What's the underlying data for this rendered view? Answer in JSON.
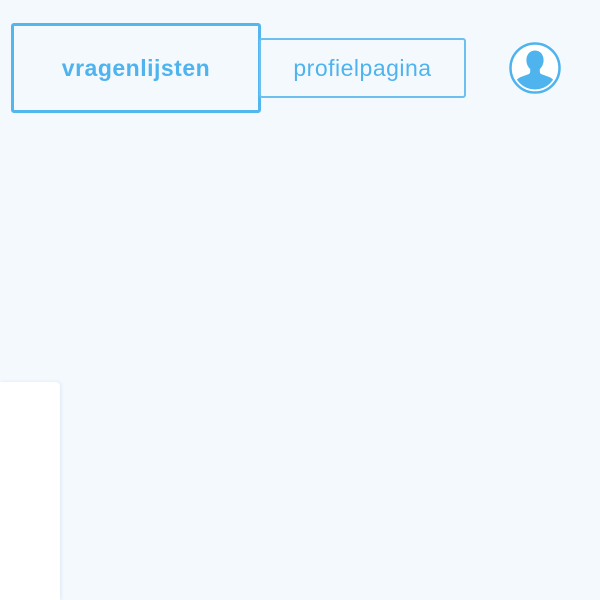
{
  "nav": {
    "tabs": [
      {
        "label": "vragenlijsten",
        "active": true
      },
      {
        "label": "profielpagina",
        "active": false
      }
    ],
    "profile_icon": "user-avatar-icon"
  },
  "colors": {
    "background": "#f4f9fe",
    "accent": "#4fb3ee",
    "panel": "#ffffff"
  }
}
